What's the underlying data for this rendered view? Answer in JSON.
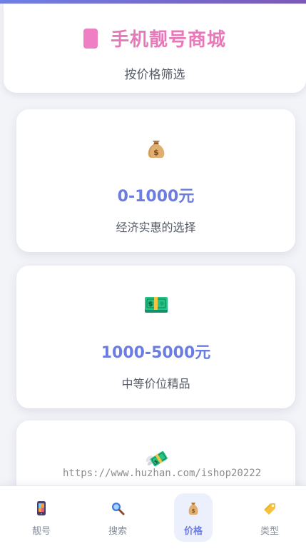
{
  "header": {
    "title": "手机靓号商城",
    "subtitle": "按价格筛选",
    "icon": "phone-icon"
  },
  "cards": [
    {
      "icon": "money-bag-icon",
      "price": "0-1000元",
      "desc": "经济实惠的选择"
    },
    {
      "icon": "dollar-banknote-icon",
      "price": "1000-5000元",
      "desc": "中等价位精品"
    },
    {
      "icon": "money-with-wings-icon",
      "price": "",
      "desc": ""
    }
  ],
  "watermark": "https://www.huzhan.com/ishop20222",
  "bottom_nav": {
    "items": [
      {
        "label": "靓号",
        "icon": "mobile-phone-icon"
      },
      {
        "label": "搜索",
        "icon": "magnifier-icon"
      },
      {
        "label": "价格",
        "icon": "money-bag-icon",
        "active": true
      },
      {
        "label": "类型",
        "icon": "tag-icon"
      }
    ]
  },
  "colors": {
    "accent": "#6b7de0",
    "title_pink": "#e879b8",
    "top_bar_start": "#6f7fe6",
    "top_bar_end": "#7b59b8",
    "active_tab_bg": "#eceffc"
  }
}
